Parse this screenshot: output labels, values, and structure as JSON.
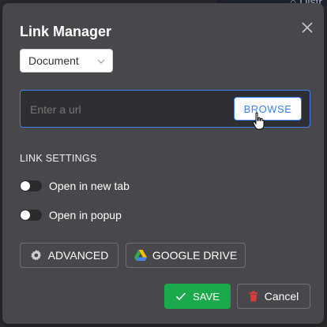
{
  "background": {
    "partial_text": "Distr"
  },
  "dialog": {
    "title": "Link Manager",
    "type_select": {
      "value": "Document"
    },
    "url_input": {
      "placeholder": "Enter a url",
      "value": ""
    },
    "browse_label": "BROWSE",
    "section_label": "LINK SETTINGS",
    "toggles": [
      {
        "label": "Open in new tab",
        "checked": false
      },
      {
        "label": "Open in popup",
        "checked": false
      }
    ],
    "advanced_label": "ADVANCED",
    "google_drive_label": "GOOGLE DRIVE",
    "save_label": "SAVE",
    "cancel_label": "Cancel"
  },
  "colors": {
    "dialog_bg": "#48484c",
    "accent_blue": "#3b82f6",
    "save_green": "#1aaa4b",
    "trash_red": "#e03a3a"
  },
  "icons": [
    "close-icon",
    "chevron-down-icon",
    "pointer-cursor-icon",
    "gear-icon",
    "google-drive-icon",
    "check-icon",
    "trash-icon",
    "home-icon"
  ]
}
